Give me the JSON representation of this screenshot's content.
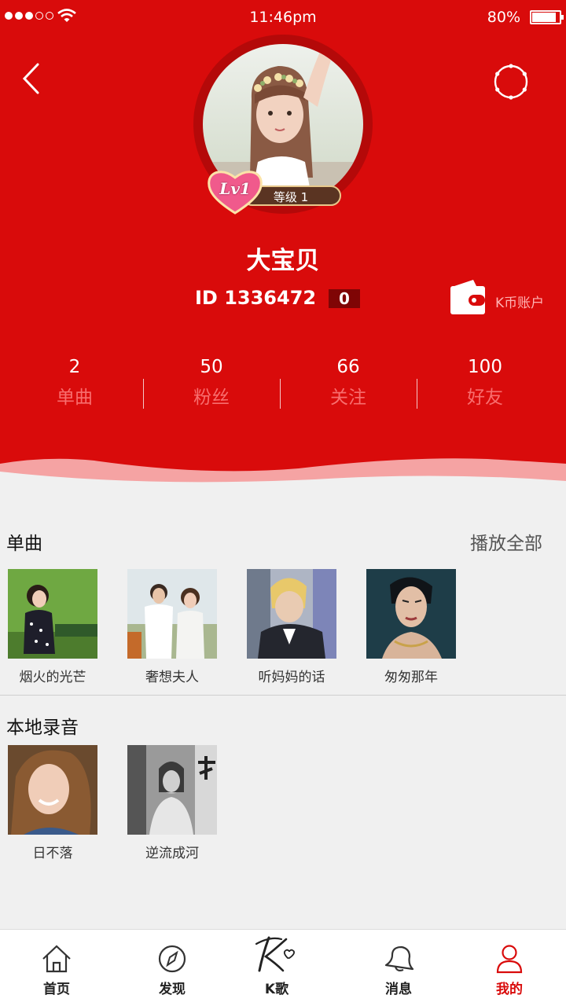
{
  "status_bar": {
    "time": "11:46pm",
    "battery": "80%"
  },
  "profile": {
    "level_badge": "Lv1",
    "level_label": "等级 1",
    "username": "大宝贝",
    "user_id": "ID 1336472",
    "id_badge": "0",
    "wallet_label": "K币账户"
  },
  "stats": [
    {
      "value": "2",
      "label": "单曲"
    },
    {
      "value": "50",
      "label": "粉丝"
    },
    {
      "value": "66",
      "label": "关注"
    },
    {
      "value": "100",
      "label": "好友"
    }
  ],
  "singles": {
    "title": "单曲",
    "play_all": "播放全部",
    "items": [
      {
        "title": "烟火的光芒"
      },
      {
        "title": "奢想夫人"
      },
      {
        "title": "听妈妈的话"
      },
      {
        "title": "匆匆那年"
      }
    ]
  },
  "recordings": {
    "title": "本地录音",
    "items": [
      {
        "title": "日不落"
      },
      {
        "title": "逆流成河"
      }
    ]
  },
  "tabbar": {
    "items": [
      {
        "label": "首页",
        "icon": "home-icon"
      },
      {
        "label": "发现",
        "icon": "compass-icon"
      },
      {
        "label": "K歌",
        "icon": "k-song-icon"
      },
      {
        "label": "消息",
        "icon": "bell-icon"
      },
      {
        "label": "我的",
        "icon": "person-icon"
      }
    ],
    "active_index": 4
  },
  "colors": {
    "brand_red": "#d90b0b",
    "stat_label": "#f86e6e",
    "background": "#f0f0f0"
  }
}
